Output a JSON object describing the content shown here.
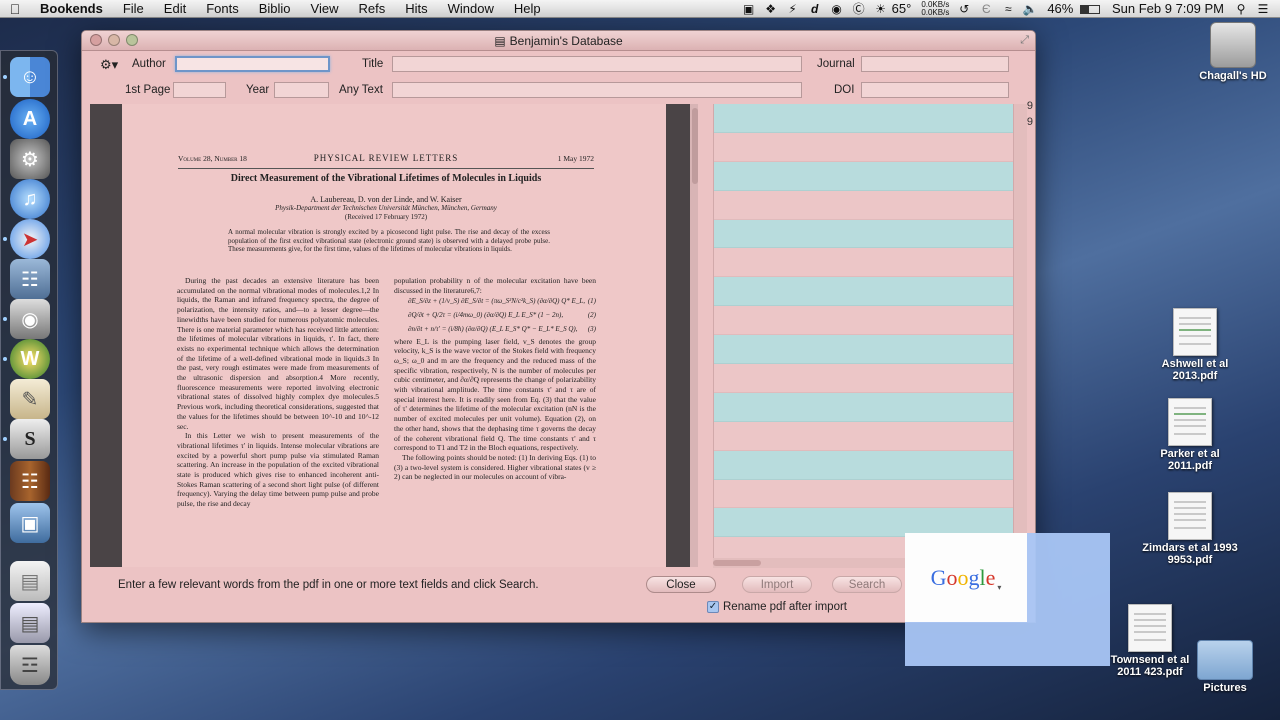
{
  "menubar": {
    "apple_icon": "apple-logo",
    "app_name": "Bookends",
    "items": [
      "File",
      "Edit",
      "Fonts",
      "Biblio",
      "View",
      "Refs",
      "Hits",
      "Window",
      "Help"
    ],
    "temperature": "65°",
    "net_up": "0.0KB/s",
    "net_down": "0.0KB/s",
    "battery": "46%",
    "clock": "Sun Feb 9  7:09 PM"
  },
  "window": {
    "title": "Benjamin's Database",
    "search": {
      "author_label": "Author",
      "author_value": "",
      "title_label": "Title",
      "journal_label": "Journal",
      "first_page_label": "1st Page",
      "year_label": "Year",
      "any_text_label": "Any Text",
      "doi_label": "DOI"
    },
    "pdf": {
      "volume": "Volume 28, Number 18",
      "journal": "PHYSICAL REVIEW LETTERS",
      "date": "1 May 1972",
      "title": "Direct Measurement of the Vibrational Lifetimes of Molecules in Liquids",
      "authors": "A. Laubereau, D. von der Linde, and W. Kaiser",
      "affiliation": "Physik-Department der Technischen Universität München, München, Germany",
      "received": "(Received 17 February 1972)",
      "abstract": "A normal molecular vibration is strongly excited by a picosecond light pulse. The rise and decay of the excess population of the first excited vibrational state (electronic ground state) is observed with a delayed probe pulse. These measurements give, for the first time, values of the lifetimes of molecular vibrations in liquids.",
      "left_col_p1": "During the past decades an extensive literature has been accumulated on the normal vibrational modes of molecules.1,2 In liquids, the Raman and infrared frequency spectra, the degree of polarization, the intensity ratios, and—to a lesser degree—the linewidths have been studied for numerous polyatomic molecules. There is one material parameter which has received little attention: the lifetimes of molecular vibrations in liquids, τ'. In fact, there exists no experimental technique which allows the determination of the lifetime of a well-defined vibrational mode in liquids.3 In the past, very rough estimates were made from measurements of the ultrasonic dispersion and absorption.4 More recently, fluorescence measurements were reported involving electronic vibrational states of dissolved highly complex dye molecules.5 Previous work, including theoretical considerations, suggested that the values for the lifetimes should be between 10^-10 and 10^-12 sec.",
      "left_col_p2": "In this Letter we wish to present measurements of the vibrational lifetimes τ' in liquids. Intense molecular vibrations are excited by a powerful short pump pulse via stimulated Raman scattering. An increase in the population of the excited vibrational state is produced which gives rise to enhanced incoherent anti-Stokes Raman scattering of a second short light pulse (of different frequency). Varying the delay time between pump pulse and probe pulse, the rise and decay",
      "right_col_p1": "population probability n of the molecular excitation have been discussed in the literature6,7:",
      "eq1": "∂E_S/∂z + (1/v_S) ∂E_S/∂t = (πω_S²N/c²k_S) (∂α/∂Q) Q* E_L,",
      "eq1_num": "(1)",
      "eq2": "∂Q/∂t + Q/2τ = (i/4mω_0) (∂α/∂Q) E_L E_S* (1 − 2n),",
      "eq2_num": "(2)",
      "eq3": "∂n/∂t + n/τ' = (i/8ħ) (∂α/∂Q) (E_L E_S* Q* − E_L* E_S Q),",
      "eq3_num": "(3)",
      "right_col_p2": "where E_L is the pumping laser field, v_S denotes the group velocity, k_S is the wave vector of the Stokes field with frequency ω_S; ω_0 and m are the frequency and the reduced mass of the specific vibration, respectively, N is the number of molecules per cubic centimeter, and ∂α/∂Q represents the change of polarizability with vibrational amplitude. The time constants τ' and τ are of special interest here. It is readily seen from Eq. (3) that the value of τ' determines the lifetime of the molecular excitation (nN is the number of excited molecules per unit volume). Equation (2), on the other hand, shows that the dephasing time τ governs the decay of the coherent vibrational field Q. The time constants τ' and τ correspond to T1 and T2 in the Bloch equations, respectively.",
      "right_col_p3": "The following points should be noted: (1) In deriving Eqs. (1) to (3) a two-level system is considered. Higher vibrational states (v ≥ 2) can be neglected in our molecules on account of vibra-"
    },
    "row_numbers": [
      "9",
      "9"
    ],
    "status_text": "Enter a few relevant words from the pdf in one or more text fields and click Search.",
    "buttons": {
      "close": "Close",
      "import": "Import",
      "search": "Search"
    },
    "rename_checkbox": {
      "label": "Rename pdf after import",
      "checked": true
    }
  },
  "google_overlay": {
    "letters": [
      "G",
      "o",
      "o",
      "g",
      "l",
      "e"
    ]
  },
  "desktop": {
    "icons": [
      {
        "label": "Chagall's HD",
        "icon": "hard-drive-icon"
      },
      {
        "label": "Ashwell et al 2013.pdf",
        "icon": "pdf-icon"
      },
      {
        "label": "Parker et al 2011.pdf",
        "icon": "pdf-icon"
      },
      {
        "label": "Zimdars et al 1993 9953.pdf",
        "icon": "pdf-icon"
      },
      {
        "label": "Townsend et al 2011 423.pdf",
        "icon": "pdf-icon"
      },
      {
        "label": "Pictures",
        "icon": "folder-icon"
      }
    ]
  },
  "dock": {
    "items": [
      "finder-icon",
      "app-store-icon",
      "system-preferences-icon",
      "itunes-icon",
      "safari-icon",
      "preview-icon",
      "iphoto-icon",
      "bookends-icon",
      "text-edit-icon",
      "scrivener-icon",
      "books-icon",
      "screen-icon",
      "document-icon",
      "stack-icon",
      "trash-icon"
    ]
  },
  "colors": {
    "window_bg": "#ecc3c4",
    "selected_row": "#b8dcdd",
    "focus_ring": "#6e95c9"
  }
}
